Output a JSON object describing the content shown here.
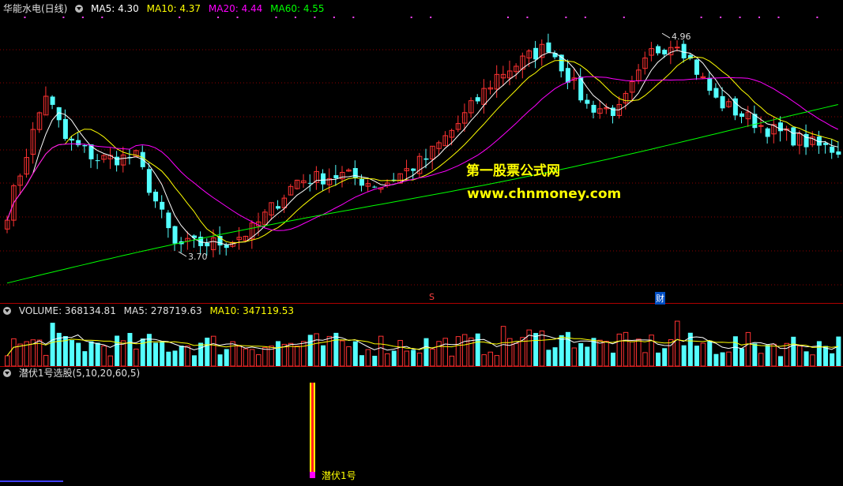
{
  "header_price": {
    "stock_label": "华能水电(日线)",
    "ma5": "MA5: 4.30",
    "ma10": "MA10: 4.37",
    "ma20": "MA20: 4.44",
    "ma60": "MA60: 4.55"
  },
  "header_volume": {
    "volume": "VOLUME: 368134.81",
    "ma5": "MA5: 278719.63",
    "ma10": "MA10: 347119.53"
  },
  "header_indicator": {
    "title": "潜伏1号选股(5,10,20,60,5)"
  },
  "annotations": {
    "high_label": "4.96",
    "low_label": "3.70",
    "signal_label": "潜伏1号",
    "event_s": "S",
    "event_cai": "财"
  },
  "watermark": {
    "line1": "第一股票公式网",
    "line2": "www.chnmoney.com"
  },
  "colors": {
    "up": "#ff3232",
    "down": "#54ffff",
    "ma5": "#ffffff",
    "ma10": "#ffff00",
    "ma20": "#ff00ff",
    "ma60": "#00ff00",
    "grid": "#8b0000",
    "separator": "#b00000"
  },
  "chart_data": {
    "type": "candlestick",
    "n_bars": 130,
    "y_range": [
      3.5,
      5.05
    ],
    "ohlc_keypoints": [
      [
        0,
        3.95
      ],
      [
        6,
        4.62
      ],
      [
        9,
        4.36
      ],
      [
        14,
        4.25
      ],
      [
        20,
        4.26
      ],
      [
        26,
        3.76
      ],
      [
        34,
        3.78
      ],
      [
        38,
        3.85
      ],
      [
        45,
        4.13
      ],
      [
        52,
        4.16
      ],
      [
        58,
        4.1
      ],
      [
        65,
        4.25
      ],
      [
        70,
        4.45
      ],
      [
        76,
        4.72
      ],
      [
        84,
        4.89
      ],
      [
        90,
        4.55
      ],
      [
        95,
        4.52
      ],
      [
        100,
        4.85
      ],
      [
        104,
        4.92
      ],
      [
        110,
        4.58
      ],
      [
        118,
        4.42
      ],
      [
        126,
        4.32
      ],
      [
        129,
        4.3
      ]
    ],
    "marked_high": 4.96,
    "marked_low": 3.7,
    "volume_range": [
      0,
      600000
    ],
    "volume_last": 368134.81,
    "signal_bar_index": 47,
    "signal_name": "潜伏1号"
  }
}
